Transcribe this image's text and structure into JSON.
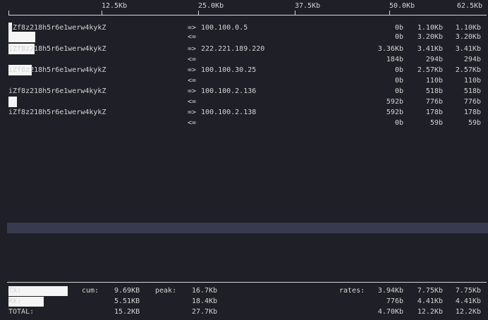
{
  "scale": {
    "labels": [
      "12.5Kb",
      "25.0Kb",
      "37.5Kb",
      "50.0Kb",
      "62.5Kb"
    ]
  },
  "connections": [
    {
      "host": "iZf8z218h5r6e1werw4kykZ",
      "peer": "100.100.0.5",
      "out": {
        "dir": "=>",
        "last2s": "0b",
        "last10s": "1.10Kb",
        "last40s": "1.10Kb"
      },
      "in": {
        "dir": "<=",
        "last2s": "0b",
        "last10s": "3.20Kb",
        "last40s": "3.20Kb"
      }
    },
    {
      "host": "iZf8z218h5r6e1werw4kykZ",
      "peer": "222.221.189.220",
      "out": {
        "dir": "=>",
        "last2s": "3.36Kb",
        "last10s": "3.41Kb",
        "last40s": "3.41Kb"
      },
      "in": {
        "dir": "<=",
        "last2s": "184b",
        "last10s": "294b",
        "last40s": "294b"
      }
    },
    {
      "host": "iZf8z218h5r6e1werw4kykZ",
      "peer": "100.100.30.25",
      "out": {
        "dir": "=>",
        "last2s": "0b",
        "last10s": "2.57Kb",
        "last40s": "2.57Kb"
      },
      "in": {
        "dir": "<=",
        "last2s": "0b",
        "last10s": "110b",
        "last40s": "110b"
      }
    },
    {
      "host": "iZf8z218h5r6e1werw4kykZ",
      "peer": "100.100.2.136",
      "out": {
        "dir": "=>",
        "last2s": "0b",
        "last10s": "518b",
        "last40s": "518b"
      },
      "in": {
        "dir": "<=",
        "last2s": "592b",
        "last10s": "776b",
        "last40s": "776b"
      }
    },
    {
      "host": "iZf8z218h5r6e1werw4kykZ",
      "peer": "100.100.2.138",
      "out": {
        "dir": "=>",
        "last2s": "592b",
        "last10s": "178b",
        "last40s": "178b"
      },
      "in": {
        "dir": "<=",
        "last2s": "0b",
        "last10s": "59b",
        "last40s": "59b"
      }
    }
  ],
  "footer": {
    "tx": {
      "label": "TX:",
      "cum_label": "cum:",
      "cum": "9.69KB",
      "peak_label": "peak:",
      "peak": "16.7Kb",
      "rates_label": "rates:",
      "r1": "3.94Kb",
      "r2": "7.75Kb",
      "r3": "7.75Kb"
    },
    "rx": {
      "label": "RX:",
      "cum": "5.51KB",
      "peak": "18.4Kb",
      "r1": "776b",
      "r2": "4.41Kb",
      "r3": "4.41Kb"
    },
    "total": {
      "label": "TOTAL:",
      "cum": "15.2KB",
      "peak": "27.7Kb",
      "r1": "4.70Kb",
      "r2": "12.2Kb",
      "r3": "12.2Kb"
    }
  },
  "colors": {
    "background": "#1f1f27",
    "foreground": "#d4d4d4",
    "bar": "#f5f5f5",
    "selection": "#383b4f"
  }
}
